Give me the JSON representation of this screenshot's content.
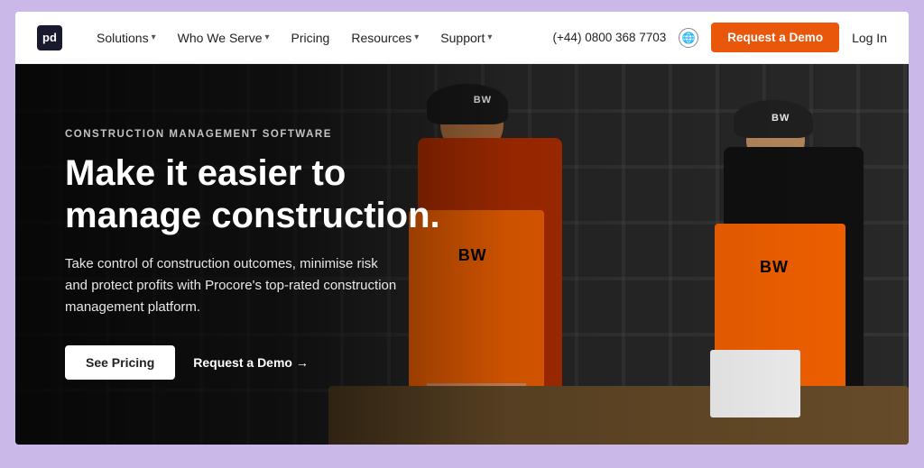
{
  "brand": {
    "logo_text": "pd",
    "logo_label": "Procore logo"
  },
  "nav": {
    "items": [
      {
        "label": "Solutions",
        "has_dropdown": true
      },
      {
        "label": "Who We Serve",
        "has_dropdown": true
      },
      {
        "label": "Pricing",
        "has_dropdown": false
      },
      {
        "label": "Resources",
        "has_dropdown": true
      },
      {
        "label": "Support",
        "has_dropdown": true
      }
    ],
    "phone": "(+44) 0800 368 7703",
    "demo_button": "Request a Demo",
    "login_button": "Log In"
  },
  "hero": {
    "label": "Construction Management Software",
    "title": "Make it easier to manage construction.",
    "description": "Take control of construction outcomes, minimise risk and protect profits with Procore's top-rated construction management platform.",
    "btn_pricing": "See Pricing",
    "btn_demo": "Request a Demo →"
  }
}
